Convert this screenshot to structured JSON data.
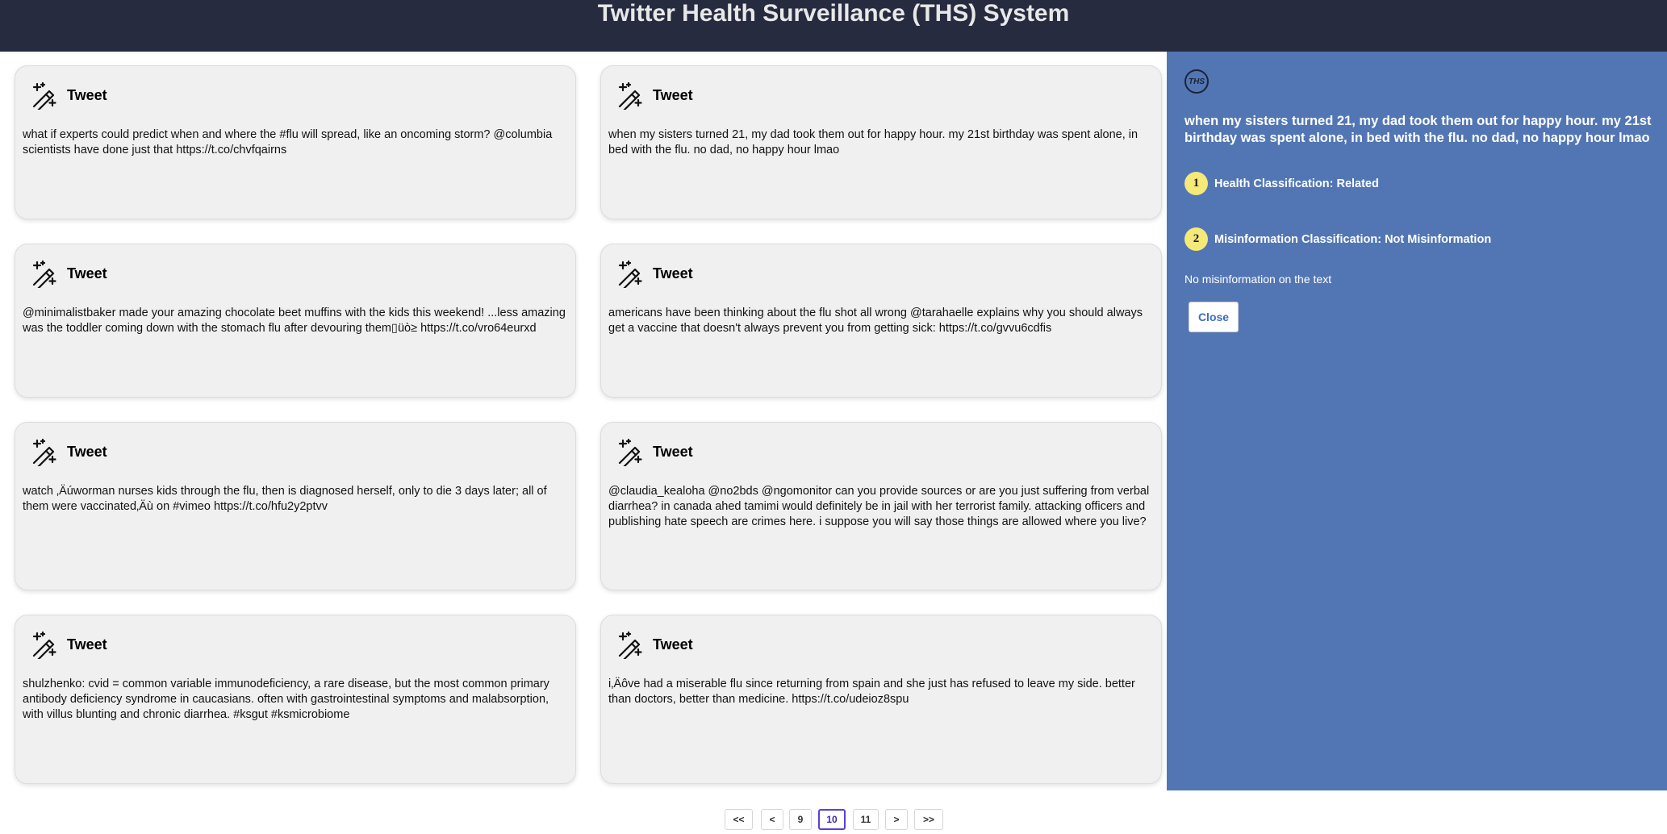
{
  "header": {
    "title": "Twitter Health Surveillance (THS) System"
  },
  "cards": [
    {
      "title": "Tweet",
      "text": "what if experts could predict when and where the #flu will spread, like an oncoming storm? @columbia scientists have done just that https://t.co/chvfqairns"
    },
    {
      "title": "Tweet",
      "text": "when my sisters turned 21, my dad took them out for happy hour. my 21st birthday was spent alone, in bed with the flu. no dad, no happy hour lmao"
    },
    {
      "title": "Tweet",
      "text": "@minimalistbaker made your amazing chocolate beet muffins with the kids this weekend! ...less amazing was the toddler coming down with the stomach flu after devouring them▯üò≥ https://t.co/vro64eurxd"
    },
    {
      "title": "Tweet",
      "text": "americans have been thinking about the flu shot all wrong @tarahaelle explains why you should always get a vaccine that doesn't always prevent you from getting sick: https://t.co/gvvu6cdfis"
    },
    {
      "title": "Tweet",
      "text": "watch ‚Äúworman nurses kids through the flu, then is diagnosed herself, only to die 3 days later; all of them were vaccinated‚Äù on #vimeo https://t.co/hfu2y2ptvv"
    },
    {
      "title": "Tweet",
      "text": "@claudia_kealoha @no2bds @ngomonitor can you provide sources or are you just suffering from verbal diarrhea? in canada ahed tamimi would definitely be in jail with her terrorist family. attacking officers and publishing hate speech are crimes here. i suppose you will say those things are allowed where you live?"
    },
    {
      "title": "Tweet",
      "text": "shulzhenko: cvid = common variable immunodeficiency, a rare disease, but the most common primary antibody deficiency syndrome in caucasians. often with gastrointestinal symptoms and malabsorption, with villus blunting and chronic diarrhea. #ksgut #ksmicrobiome"
    },
    {
      "title": "Tweet",
      "text": "i‚Äôve had a miserable flu since returning from spain and she just has refused to leave my side. better than doctors, better than medicine. https://t.co/udeioz8spu"
    }
  ],
  "panel": {
    "logo_text": "THS",
    "tweet_text": "when my sisters turned 21, my dad took them out for happy hour. my 21st birthday was spent alone, in bed with the flu. no dad, no happy hour lmao",
    "steps": [
      {
        "num": "1",
        "label": "Health Classification: Related"
      },
      {
        "num": "2",
        "label": "Misinformation Classification: Not Misinformation"
      }
    ],
    "note": "No misinformation on the text",
    "close_label": "Close"
  },
  "pagination": {
    "first": "<<",
    "prev": "<",
    "pages": [
      "9",
      "10",
      "11"
    ],
    "current": "10",
    "next": ">",
    "last": ">>"
  },
  "colors": {
    "header_bg": "#262b40",
    "panel_bg": "#5276b4",
    "step_badge": "#f5e977",
    "active_page_border": "#5b3fd6"
  },
  "icons": {
    "card_icon": "magic-wand-icon"
  }
}
